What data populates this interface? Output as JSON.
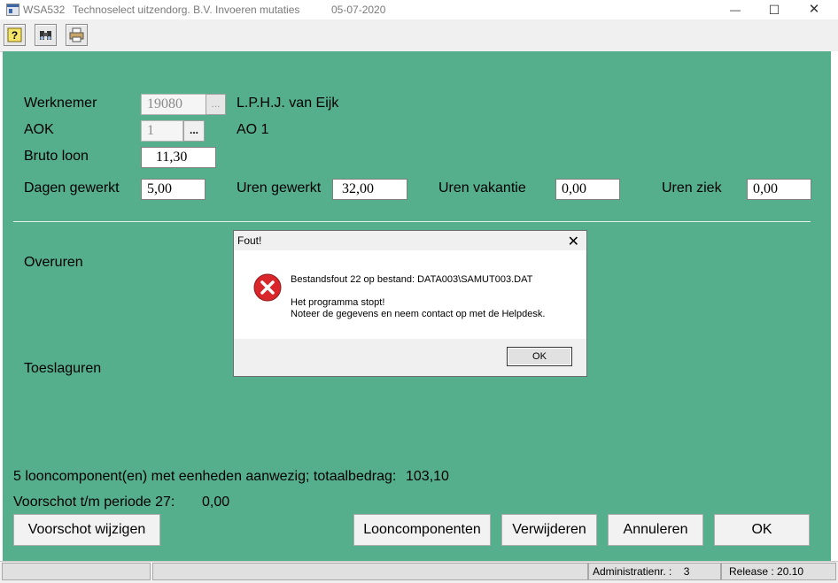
{
  "window": {
    "app_code": "WSA532",
    "company": "Technoselect uitzendorg. B.V.",
    "screen_title": "Invoeren mutaties",
    "date": "05-07-2020",
    "minimize_label": "—",
    "maximize_label": "☐",
    "close_label": "✕"
  },
  "toolbar": {
    "icons": [
      "help-icon",
      "binoculars-icon",
      "print-icon"
    ]
  },
  "form": {
    "werknemer_label": "Werknemer",
    "werknemer_value": "19080",
    "werknemer_name": "L.P.H.J. van Eijk",
    "aok_label": "AOK",
    "aok_value": "1",
    "aok_description": "AO 1",
    "lookup_label": "...",
    "bruto_label": "Bruto loon",
    "bruto_value": "11,30",
    "dagen_label": "Dagen gewerkt",
    "dagen_value": "5,00",
    "uren_label": "Uren gewerkt",
    "uren_value": "32,00",
    "vakantie_label": "Uren vakantie",
    "vakantie_value": "0,00",
    "ziek_label": "Uren ziek",
    "ziek_value": "0,00",
    "overuren_label": "Overuren",
    "toeslaguren_label": "Toeslaguren",
    "summary_text": "5 looncomponent(en) met eenheden aanwezig; totaalbedrag:",
    "summary_amount": "103,10",
    "voorschot_text": "Voorschot t/m periode 27:",
    "voorschot_amount": "0,00"
  },
  "buttons": {
    "voorschot_wijzigen": "Voorschot wijzigen",
    "looncomponenten": "Looncomponenten",
    "verwijderen": "Verwijderen",
    "annuleren": "Annuleren",
    "ok": "OK"
  },
  "statusbar": {
    "admin_label": "Administratienr. :",
    "admin_value": "3",
    "release_label": "Release : 20.10"
  },
  "dialog": {
    "title": "Fout!",
    "close_label": "✕",
    "line1": "Bestandsfout 22 op bestand: DATA003\\SAMUT003.DAT",
    "line2": "Het programma stopt!",
    "line3": "Noteer de gegevens en neem contact op met de Helpdesk.",
    "ok_label": "OK"
  },
  "colors": {
    "form_background": "#55ae8c",
    "error_icon": "#d9262b"
  }
}
